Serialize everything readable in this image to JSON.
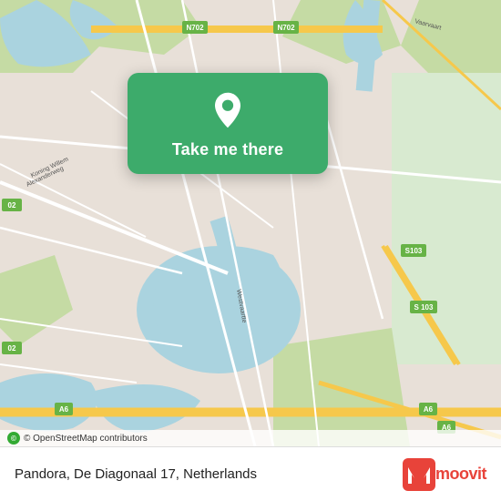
{
  "map": {
    "attribution_logo": "©",
    "attribution_text": "© OpenStreetMap contributors",
    "colors": {
      "water": "#aad3df",
      "land": "#e8e0d8",
      "green_area": "#b5d29e",
      "road_white": "#ffffff",
      "road_yellow": "#f6c84b",
      "road_label_bg": "#67b346"
    }
  },
  "location_card": {
    "button_label": "Take me there",
    "pin_color": "#ffffff"
  },
  "road_labels": [
    {
      "id": "n702_top",
      "label": "N702"
    },
    {
      "id": "n702_mid",
      "label": "N702"
    },
    {
      "id": "a6_bottom_left",
      "label": "A6"
    },
    {
      "id": "a6_bottom_right",
      "label": "A6"
    },
    {
      "id": "s103_right",
      "label": "S103"
    },
    {
      "id": "s103_bottom_right",
      "label": "S 103"
    },
    {
      "id": "o2_left",
      "label": "02"
    },
    {
      "id": "o2_bottom",
      "label": "02"
    }
  ],
  "footer": {
    "address": "Pandora, De Diagonaal 17, Netherlands",
    "logo_text": "moovit"
  }
}
